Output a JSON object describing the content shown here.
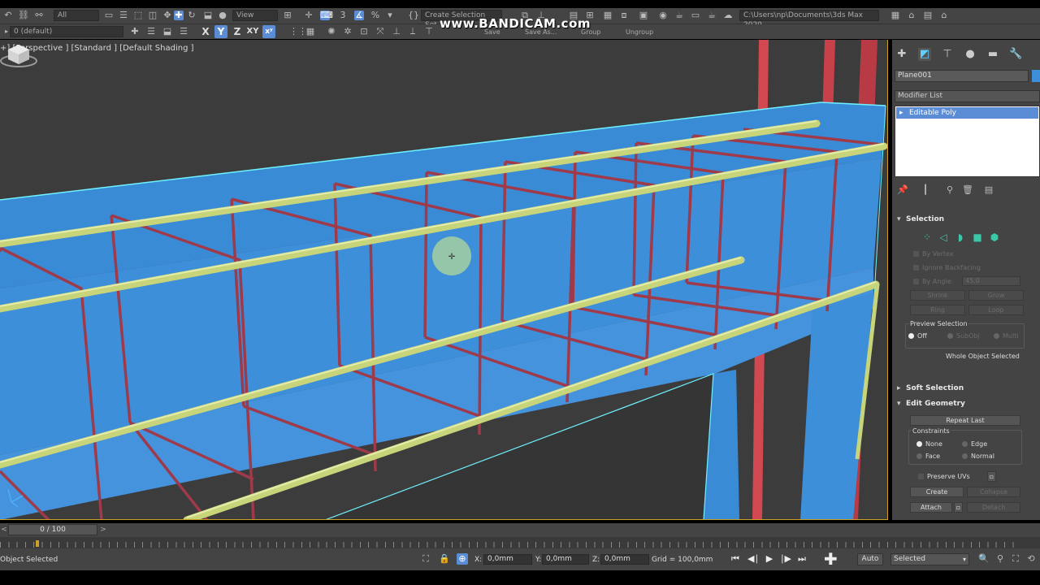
{
  "watermark": "www.BANDICAM.com",
  "toolbar": {
    "filter_select": "All",
    "view_select": "View",
    "selection_set": "Create Selection Set",
    "layer": "0 (default)",
    "path": "C:\\Users\\np\\Documents\\3ds Max 2020",
    "axis_x": "X",
    "axis_y": "Y",
    "axis_z": "Z",
    "axis_xy": "XY",
    "save_label": "Save",
    "save_as_label": "Save As...",
    "group_label": "Group",
    "ungroup_label": "Ungroup"
  },
  "viewport": {
    "label": "+] [Perspective ] [Standard ] [Default Shading ]"
  },
  "command_panel": {
    "object_name": "Plane001",
    "object_color": "#3e8fd9",
    "modifier_list": "Modifier List",
    "stack_item": "Editable Poly",
    "selection": {
      "title": "Selection",
      "by_vertex": "By Vertex",
      "ignore_backfacing": "Ignore Backfacing",
      "by_angle": "By Angle:",
      "angle_value": "45,0",
      "shrink": "Shrink",
      "grow": "Grow",
      "ring": "Ring",
      "loop": "Loop",
      "preview_title": "Preview Selection",
      "preview_off": "Off",
      "preview_subobj": "SubObj",
      "preview_multi": "Multi",
      "status": "Whole Object Selected"
    },
    "soft_selection": "Soft Selection",
    "edit_geometry": {
      "title": "Edit Geometry",
      "repeat_last": "Repeat Last",
      "constraints": "Constraints",
      "none": "None",
      "edge": "Edge",
      "face": "Face",
      "normal": "Normal",
      "preserve_uvs": "Preserve UVs",
      "create": "Create",
      "collapse": "Collapse",
      "attach": "Attach",
      "detach": "Detach"
    }
  },
  "timeline": {
    "frame": "0 / 100"
  },
  "status": {
    "text": "Object Selected",
    "x_label": "X:",
    "x_value": "0,0mm",
    "y_label": "Y:",
    "y_value": "0,0mm",
    "z_label": "Z:",
    "z_value": "0,0mm",
    "grid": "Grid = 100,0mm",
    "auto_key": "Auto",
    "selected_set": "Selected"
  },
  "colors": {
    "beam_blue": "#3e8fd9",
    "rebar_red": "#9e3a4a",
    "rebar_yellow": "#c7d47a",
    "column_red": "#d14850",
    "selection_cyan": "#6ff2ff",
    "viewport_border": "#c9a227",
    "highlight_blue": "#5a8dd6"
  },
  "icons": [
    "undo-icon",
    "redo-icon",
    "link-icon",
    "select-icon",
    "move-icon",
    "rotate-icon",
    "scale-icon",
    "snap-icon",
    "viewcube-icon",
    "play-icon",
    "zoom-icon",
    "orbit-icon",
    "pin-icon"
  ]
}
